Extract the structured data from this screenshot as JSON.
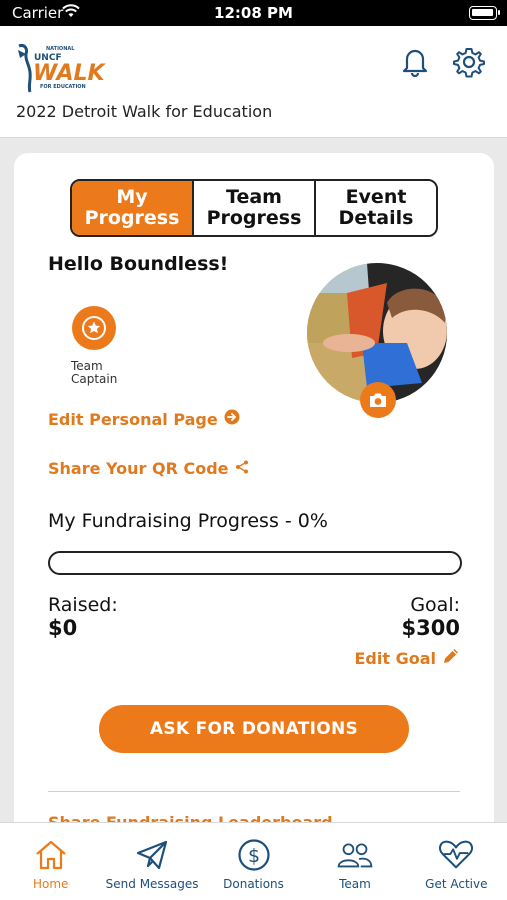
{
  "status_bar": {
    "carrier": "Carrier",
    "time": "12:08 PM"
  },
  "header": {
    "logo": {
      "line1": "NATIONAL",
      "line2": "UNCF",
      "line3": "WALK",
      "line4": "FOR EDUCATION"
    },
    "event_title": "2022 Detroit Walk for Education",
    "icons": [
      "bell-icon",
      "gear-icon"
    ]
  },
  "tabs": [
    {
      "label": "My\nProgress",
      "active": true
    },
    {
      "label": "Team\nProgress",
      "active": false
    },
    {
      "label": "Event\nDetails",
      "active": false
    }
  ],
  "profile": {
    "greeting": "Hello Boundless!",
    "badge_label": "Team\nCaptain",
    "edit_page_link": "Edit Personal Page",
    "share_qr_link": "Share Your QR Code"
  },
  "fundraising": {
    "title": "My Fundraising Progress - 0%",
    "progress_fraction": 0,
    "raised_label": "Raised:",
    "raised_value": "$0",
    "goal_label": "Goal:",
    "goal_value": "$300",
    "edit_goal": "Edit Goal",
    "ask_button": "ASK FOR DONATIONS",
    "partial_link": "Share Fundraising Leaderboard"
  },
  "tab_bar": [
    {
      "label": "Home",
      "icon": "home-icon",
      "active": true
    },
    {
      "label": "Send Messages",
      "icon": "paper-plane-icon",
      "active": false
    },
    {
      "label": "Donations",
      "icon": "dollar-icon",
      "active": false
    },
    {
      "label": "Team",
      "icon": "users-icon",
      "active": false
    },
    {
      "label": "Get Active",
      "icon": "heart-pulse-icon",
      "active": false
    }
  ],
  "colors": {
    "accent": "#ec7a1a",
    "navy": "#1d4f7a"
  }
}
